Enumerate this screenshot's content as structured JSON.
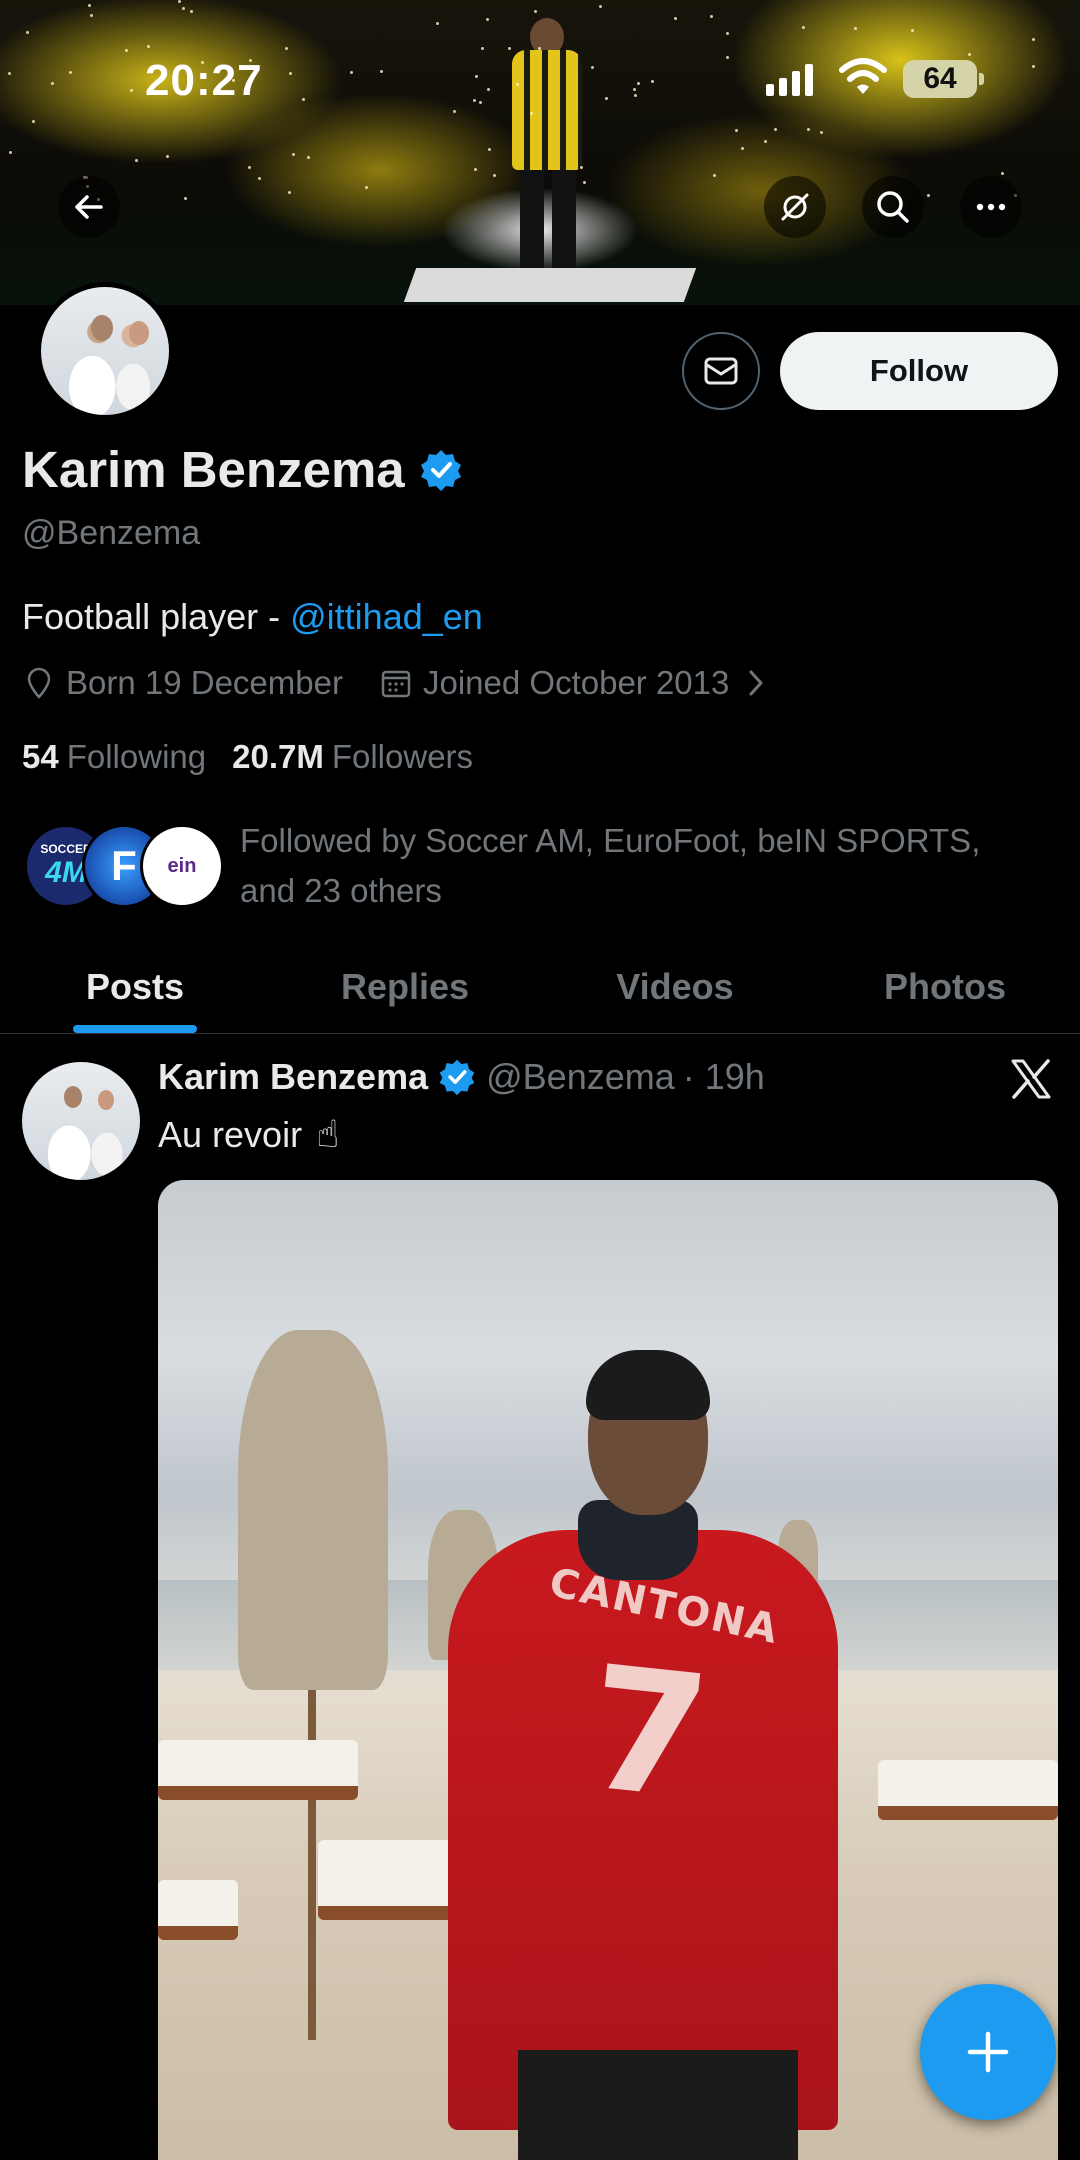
{
  "status_bar": {
    "time": "20:27",
    "battery": "64"
  },
  "profile": {
    "name": "Karim Benzema",
    "handle": "@Benzema",
    "bio_prefix": "Football player - ",
    "bio_mention": "@ittihad_en",
    "location": "Born 19 December",
    "joined": "Joined October 2013",
    "following_count": "54",
    "following_label": "Following",
    "followers_count": "20.7M",
    "followers_label": "Followers",
    "followed_by_line1": "Followed by Soccer AM, EuroFoot, beIN SPORTS,",
    "followed_by_line2": "and 23 others",
    "follow_label": "Follow",
    "followed_by_avatars": [
      {
        "name": "soccer-am-avatar",
        "text": "SOCCER"
      },
      {
        "name": "eurofoot-avatar",
        "text": "F"
      },
      {
        "name": "bein-sports-avatar",
        "text": "ein"
      }
    ]
  },
  "tabs": [
    "Posts",
    "Replies",
    "Videos",
    "Photos"
  ],
  "post": {
    "author": "Karim Benzema",
    "handle": "@Benzema",
    "time": "· 19h",
    "text": "Au revoir",
    "jersey_name": "CANTONA",
    "jersey_number": "7"
  },
  "colors": {
    "accent": "#1d9bf0",
    "background": "#000000",
    "text_primary": "#e7e9ea",
    "text_secondary": "#71767b"
  },
  "icons": {
    "back": "arrow-left-icon",
    "notifications": "no-repost-icon",
    "search": "search-icon",
    "more": "more-horizontal-icon",
    "message": "envelope-icon",
    "verified": "verified-badge-icon",
    "location": "location-pin-icon",
    "calendar": "calendar-icon",
    "chevron": "chevron-right-icon",
    "compose": "plus-icon",
    "x_logo": "x-logo-icon"
  }
}
